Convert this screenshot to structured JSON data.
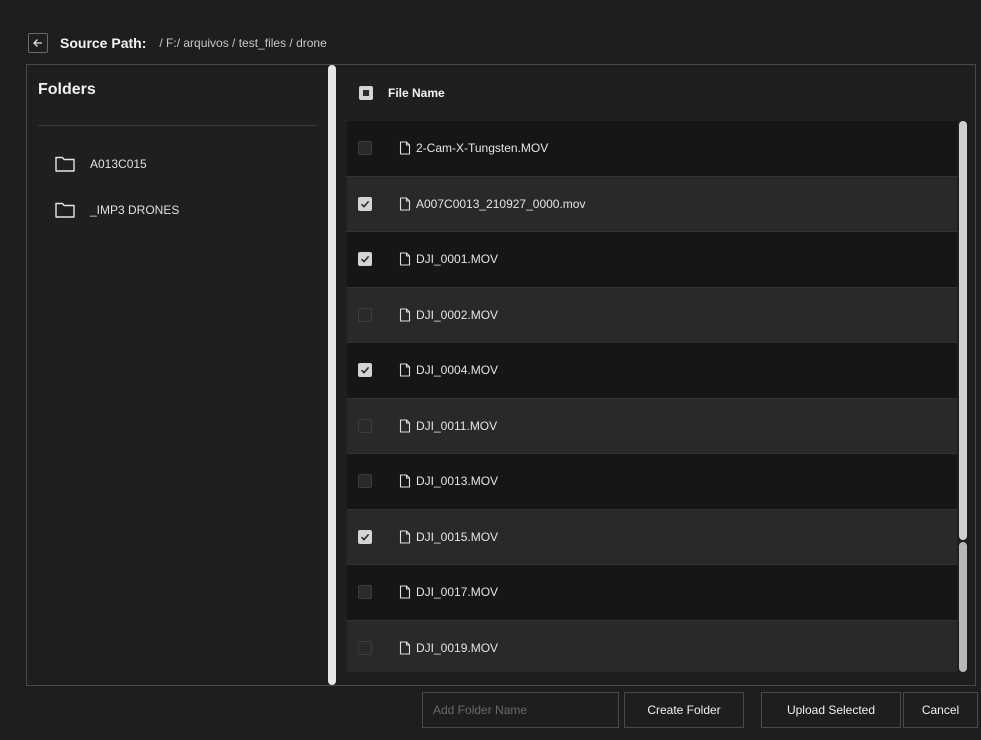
{
  "header": {
    "back_icon": "arrow-left-icon",
    "source_label": "Source Path:",
    "source_path": "/ F:/ arquivos / test_files / drone"
  },
  "folders": {
    "title": "Folders",
    "items": [
      {
        "name": "A013C015",
        "icon": "folder-icon"
      },
      {
        "name": "_IMP3 DRONES",
        "icon": "folder-icon"
      }
    ]
  },
  "files": {
    "header_label": "File Name",
    "header_checkbox_state": "indeterminate",
    "items": [
      {
        "name": "2-Cam-X-Tungsten.MOV",
        "checked": false,
        "icon": "file-icon"
      },
      {
        "name": "A007C0013_210927_0000.mov",
        "checked": true,
        "icon": "file-icon"
      },
      {
        "name": "DJI_0001.MOV",
        "checked": true,
        "icon": "file-icon"
      },
      {
        "name": "DJI_0002.MOV",
        "checked": false,
        "icon": "file-icon"
      },
      {
        "name": "DJI_0004.MOV",
        "checked": true,
        "icon": "file-icon"
      },
      {
        "name": "DJI_0011.MOV",
        "checked": false,
        "icon": "file-icon"
      },
      {
        "name": "DJI_0013.MOV",
        "checked": false,
        "icon": "file-icon"
      },
      {
        "name": "DJI_0015.MOV",
        "checked": true,
        "icon": "file-icon"
      },
      {
        "name": "DJI_0017.MOV",
        "checked": false,
        "icon": "file-icon"
      },
      {
        "name": "DJI_0019.MOV",
        "checked": false,
        "icon": "file-icon"
      }
    ]
  },
  "footer": {
    "add_folder_placeholder": "Add Folder Name",
    "add_folder_value": "",
    "create_folder_label": "Create Folder",
    "upload_selected_label": "Upload Selected",
    "cancel_label": "Cancel"
  },
  "colors": {
    "background": "#1e1e1e",
    "row_odd": "#161616",
    "row_even": "#292929",
    "checkbox_checked": "#d4d4d4",
    "border": "#4a4a4a"
  }
}
